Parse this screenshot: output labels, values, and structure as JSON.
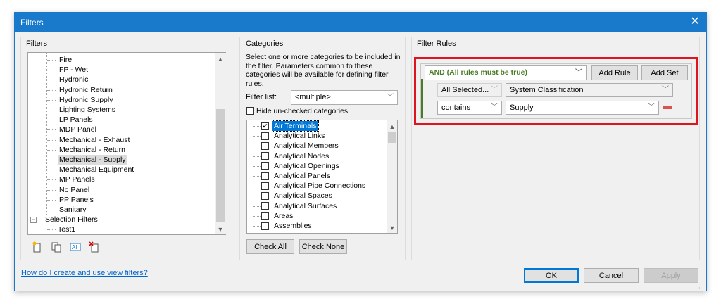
{
  "window": {
    "title": "Filters"
  },
  "filters": {
    "group_title": "Filters",
    "tree_items": [
      {
        "label": "Fire"
      },
      {
        "label": "FP - Wet"
      },
      {
        "label": "Hydronic"
      },
      {
        "label": "Hydronic Return"
      },
      {
        "label": "Hydronic Supply"
      },
      {
        "label": "Lighting Systems"
      },
      {
        "label": "LP Panels"
      },
      {
        "label": "MDP Panel"
      },
      {
        "label": "Mechanical - Exhaust"
      },
      {
        "label": "Mechanical - Return"
      },
      {
        "label": "Mechanical - Supply",
        "selected": true
      },
      {
        "label": "Mechanical Equipment"
      },
      {
        "label": "MP Panels"
      },
      {
        "label": "No Panel"
      },
      {
        "label": "PP Panels"
      },
      {
        "label": "Sanitary"
      }
    ],
    "selection_filters": {
      "label": "Selection Filters",
      "expander": "−",
      "children": [
        {
          "label": "Test1"
        }
      ]
    },
    "toolbar_icons": [
      "new-filter-icon",
      "duplicate-icon",
      "rename-icon",
      "delete-icon"
    ]
  },
  "categories": {
    "group_title": "Categories",
    "description": "Select one or more categories to be included in the filter.  Parameters common to these categories will be available for defining filter rules.",
    "filter_list_label": "Filter list:",
    "filter_list_value": "<multiple>",
    "hide_unchecked_label": "Hide un-checked categories",
    "hide_unchecked_checked": false,
    "items": [
      {
        "label": "Air Terminals",
        "checked": true,
        "selected": true
      },
      {
        "label": "Analytical Links",
        "checked": false
      },
      {
        "label": "Analytical Members",
        "checked": false
      },
      {
        "label": "Analytical Nodes",
        "checked": false
      },
      {
        "label": "Analytical Openings",
        "checked": false
      },
      {
        "label": "Analytical Panels",
        "checked": false
      },
      {
        "label": "Analytical Pipe Connections",
        "checked": false
      },
      {
        "label": "Analytical Spaces",
        "checked": false
      },
      {
        "label": "Analytical Surfaces",
        "checked": false
      },
      {
        "label": "Areas",
        "checked": false
      },
      {
        "label": "Assemblies",
        "checked": false
      }
    ],
    "check_all_label": "Check All",
    "check_none_label": "Check None"
  },
  "filter_rules": {
    "group_title": "Filter Rules",
    "operator": "AND (All rules must be true)",
    "add_rule_label": "Add Rule",
    "add_set_label": "Add Set",
    "rule_category": "All Selected...",
    "rule_parameter": "System Classification",
    "rule_condition": "contains",
    "rule_value": "Supply",
    "accent_color": "#4a7c26",
    "highlight_color": "#e0141e"
  },
  "footer": {
    "help_link": "How do I create and use view filters?",
    "ok_label": "OK",
    "cancel_label": "Cancel",
    "apply_label": "Apply"
  }
}
